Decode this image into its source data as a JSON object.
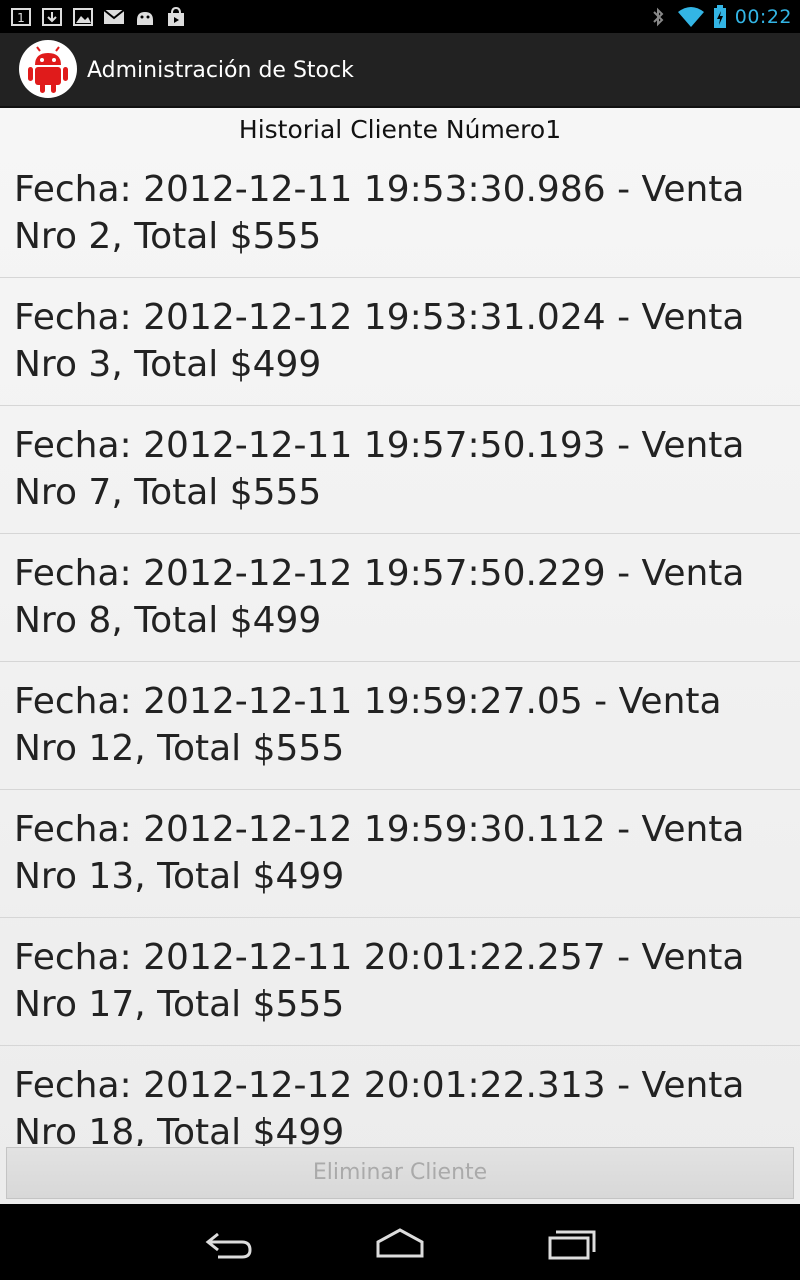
{
  "status_bar": {
    "time": "00:22",
    "left_icons": [
      "notification-1-icon",
      "download-icon",
      "image-icon",
      "gmail-icon",
      "android-debug-icon",
      "shop-bag-icon"
    ],
    "right_icons": [
      "bluetooth-icon",
      "wifi-icon",
      "battery-charging-icon"
    ]
  },
  "action_bar": {
    "title": "Administración de Stock",
    "icon": "android-app-icon"
  },
  "content": {
    "heading": "Historial Cliente Número1",
    "items": [
      {
        "line1": "Fecha: 2012-12-11 19:53:30.986 - Venta",
        "line2": "Nro 2, Total $555"
      },
      {
        "line1": "Fecha: 2012-12-12 19:53:31.024 - Venta",
        "line2": "Nro 3, Total $499"
      },
      {
        "line1": "Fecha: 2012-12-11 19:57:50.193 - Venta",
        "line2": "Nro 7, Total $555"
      },
      {
        "line1": "Fecha: 2012-12-12 19:57:50.229 - Venta",
        "line2": "Nro 8, Total $499"
      },
      {
        "line1": "Fecha: 2012-12-11 19:59:27.05 - Venta",
        "line2": "Nro 12, Total $555"
      },
      {
        "line1": "Fecha: 2012-12-12 19:59:30.112 - Venta",
        "line2": "Nro 13, Total $499"
      },
      {
        "line1": "Fecha: 2012-12-11 20:01:22.257 - Venta",
        "line2": "Nro 17, Total $555"
      },
      {
        "line1": "Fecha: 2012-12-12 20:01:22.313 - Venta",
        "line2": "Nro 18, Total $499"
      }
    ],
    "delete_button": "Eliminar Cliente"
  },
  "nav_bar": {
    "icons": [
      "back-icon",
      "home-icon",
      "recent-apps-icon"
    ]
  },
  "colors": {
    "accent": "#33b5e5",
    "action_bar": "#222222",
    "background": "#f2f2f2"
  }
}
